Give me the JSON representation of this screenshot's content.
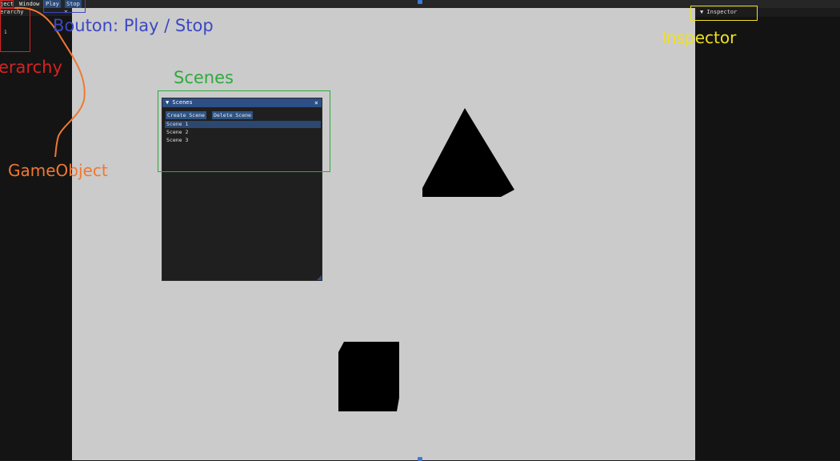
{
  "menubar": {
    "items": [
      "ject",
      "Window",
      "Play",
      "Stop"
    ]
  },
  "hierarchy": {
    "title": "erarchy",
    "close": "×",
    "items": [
      "1"
    ]
  },
  "inspector": {
    "title": "▼ Inspector"
  },
  "scenes_window": {
    "title": "▼ Scenes",
    "close": "×",
    "buttons": [
      "Create Scene",
      "Delete Scene"
    ],
    "scenes": [
      "Scene 1",
      "Scene 2",
      "Scene 3"
    ],
    "selected_index": 0
  },
  "annotations": {
    "play_stop": "Bouton: Play / Stop",
    "hierarchy": "erarchy",
    "gameobject": "GameObject",
    "scenes": "Scenes",
    "inspector": "Inspector"
  },
  "colors": {
    "viewport_bg": "#cbcbcb",
    "panel_bg": "#141414",
    "accent_blue": "#2d4f86",
    "annotation_blue": "#3b48c4",
    "annotation_red": "#d42323",
    "annotation_orange": "#f07830",
    "annotation_green": "#2eaa3c",
    "annotation_yellow": "#f0e020"
  }
}
